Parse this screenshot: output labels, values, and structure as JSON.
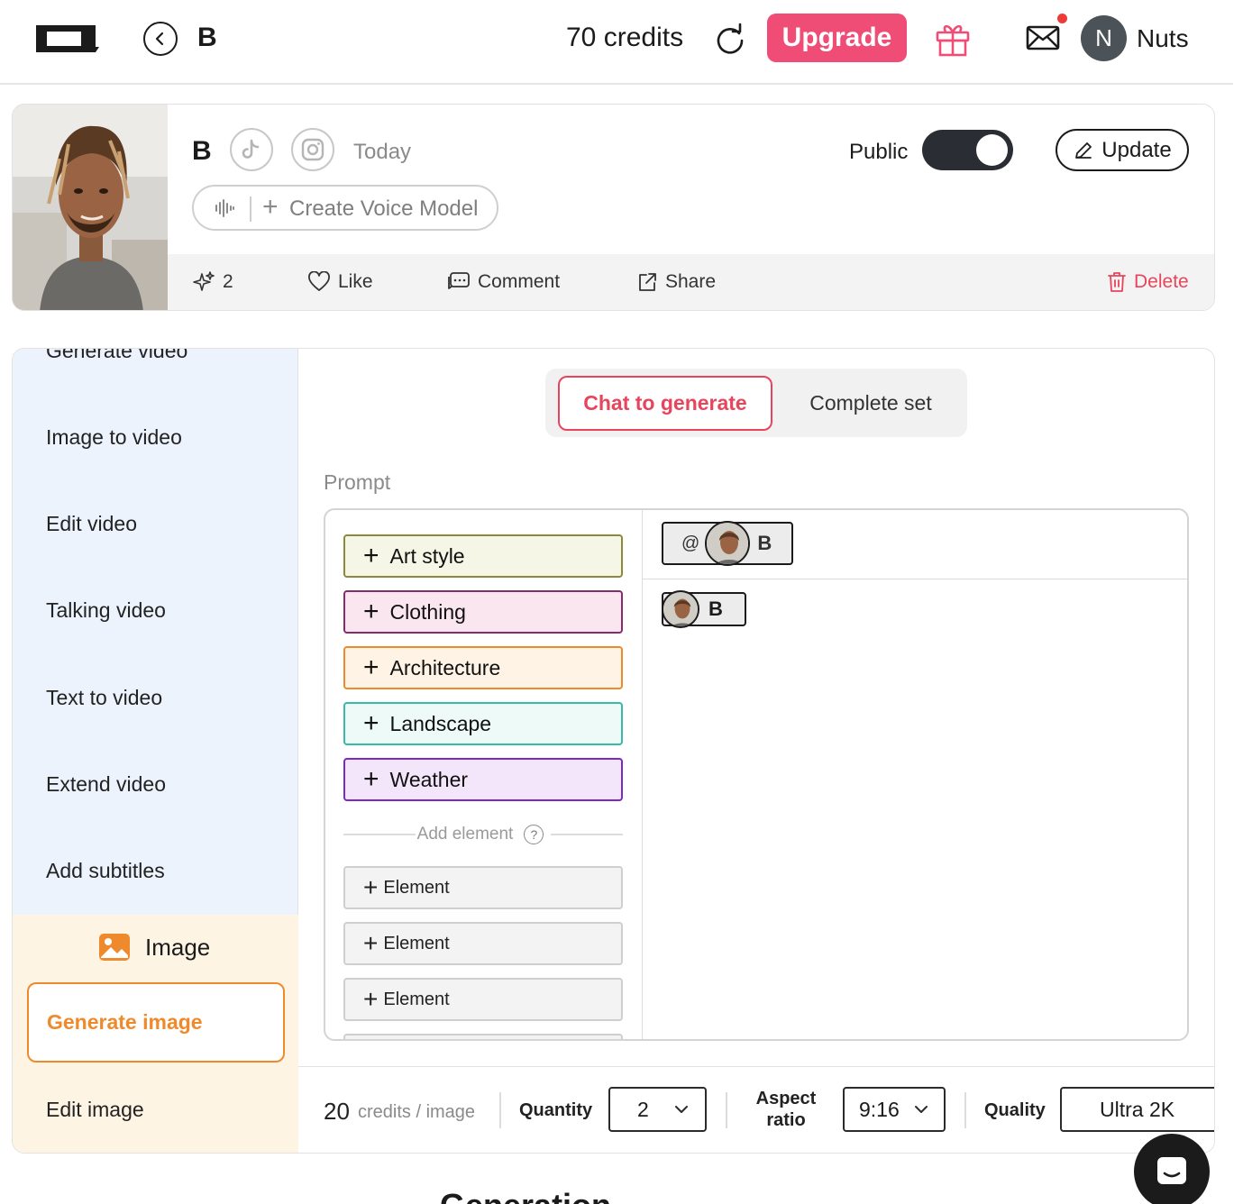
{
  "header": {
    "page_name": "B",
    "credits": "70 credits",
    "upgrade_label": "Upgrade",
    "avatar_initial": "N",
    "username": "Nuts"
  },
  "profile": {
    "name": "B",
    "date": "Today",
    "voice_button": "Create Voice Model",
    "visibility_label": "Public",
    "visibility_on": true,
    "update_label": "Update",
    "actions": {
      "generations": "2",
      "like": "Like",
      "comment": "Comment",
      "share": "Share",
      "delete": "Delete"
    }
  },
  "sidebar": {
    "video_items": [
      "Generate video",
      "Image to video",
      "Edit video",
      "Talking video",
      "Text to video",
      "Extend video",
      "Add subtitles"
    ],
    "image_section_title": "Image",
    "image_items": [
      "Generate image",
      "Edit image"
    ],
    "active_item": "Generate image"
  },
  "tabs": {
    "active": "Chat to generate",
    "other": "Complete set"
  },
  "prompt": {
    "label": "Prompt",
    "categories": [
      {
        "label": "Art style",
        "border": "#8a8a3a",
        "bg": "#f6f6e6"
      },
      {
        "label": "Clothing",
        "border": "#8a2a6a",
        "bg": "#f9e6ee"
      },
      {
        "label": "Architecture",
        "border": "#ef8a2c",
        "bg": "#fff3e6"
      },
      {
        "label": "Landscape",
        "border": "#3ab8a8",
        "bg": "#edfaf7"
      },
      {
        "label": "Weather",
        "border": "#7a2ac0",
        "bg": "#f3e6fb"
      }
    ],
    "add_element_label": "Add element",
    "help_glyph": "?",
    "element_slots": [
      "Element",
      "Element",
      "Element"
    ],
    "mention_symbol": "@",
    "mention_name": "B",
    "tag_name": "B"
  },
  "generation": {
    "cost_value": "20",
    "cost_unit": "credits / image",
    "quantity_label": "Quantity",
    "quantity_value": "2",
    "aspect_label_1": "Aspect",
    "aspect_label_2": "ratio",
    "aspect_value": "9:16",
    "quality_label": "Quality",
    "quality_value": "Ultra 2K"
  },
  "colors": {
    "accent_pink": "#ef4d76",
    "delete_red": "#e8455c",
    "image_orange": "#ef8a2c",
    "sidebar_blue": "#ecf3fd",
    "image_section_bg": "#fef4e4"
  },
  "icons": [
    "logo-icon",
    "back-icon",
    "refresh-icon",
    "gift-icon",
    "mail-icon",
    "tiktok-icon",
    "instagram-icon",
    "waveform-icon",
    "pencil-icon",
    "sparkle-icon",
    "heart-icon",
    "comment-icon",
    "share-icon",
    "trash-icon",
    "image-icon",
    "chevron-down-icon",
    "chat-support-icon"
  ],
  "below_title": "Generation"
}
